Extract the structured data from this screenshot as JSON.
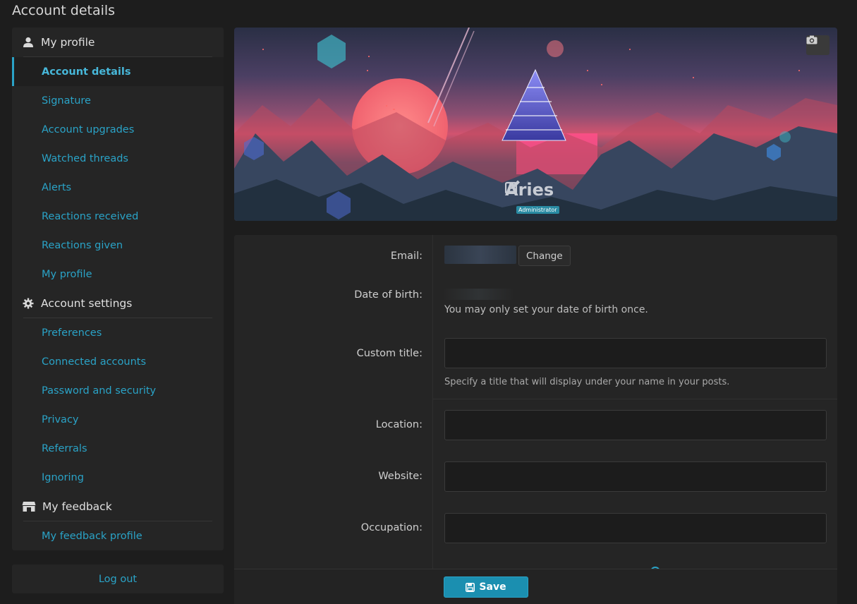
{
  "page": {
    "title": "Account details"
  },
  "sidebar": {
    "groups": [
      {
        "title": "My profile",
        "icon": "user-icon",
        "items": [
          "Account details",
          "Signature",
          "Account upgrades",
          "Watched threads",
          "Alerts",
          "Reactions received",
          "Reactions given",
          "My profile"
        ]
      },
      {
        "title": "Account settings",
        "icon": "gear-icon",
        "items": [
          "Preferences",
          "Connected accounts",
          "Password and security",
          "Privacy",
          "Referrals",
          "Ignoring"
        ]
      },
      {
        "title": "My feedback",
        "icon": "store-icon",
        "items": [
          "My feedback profile"
        ]
      }
    ],
    "active_item": "Account details",
    "logout_label": "Log out"
  },
  "banner": {
    "username": "Aries",
    "role": "Administrator",
    "camera_icon": "camera-icon",
    "edit_icon": "edit-icon"
  },
  "form": {
    "email_label": "Email:",
    "change_label": "Change",
    "dob_label": "Date of birth:",
    "dob_hint": "You may only set your date of birth once.",
    "custom_title_label": "Custom title:",
    "custom_title_value": "",
    "custom_title_hint": "Specify a title that will display under your name in your posts.",
    "location_label": "Location:",
    "location_value": "",
    "website_label": "Website:",
    "website_value": "",
    "occupation_label": "Occupation:",
    "occupation_value": ""
  },
  "footer": {
    "save_label": "Save",
    "save_icon": "save-icon"
  },
  "colors": {
    "accent": "#2aa3c7",
    "background": "#1d1d1d",
    "panel": "#252525"
  }
}
